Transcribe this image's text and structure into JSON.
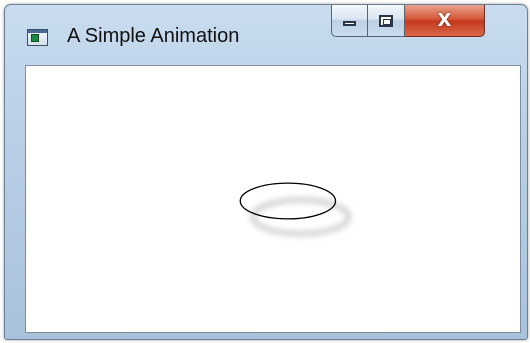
{
  "window": {
    "title": "A Simple Animation",
    "icon": "application-window-icon",
    "buttons": {
      "minimize_icon": "minimize-icon",
      "maximize_icon": "maximize-icon",
      "close_glyph": "X"
    }
  },
  "canvas": {
    "shape": "ellipse",
    "stroke_color": "#000000",
    "shadow_color": "#b3b3b3",
    "background_color": "#ffffff"
  }
}
